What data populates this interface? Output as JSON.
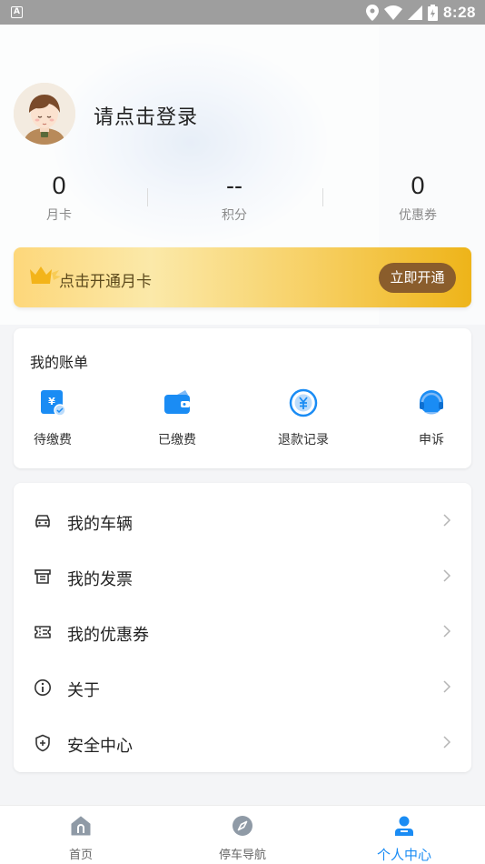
{
  "status_bar": {
    "time": "8:28",
    "app_badge": "A"
  },
  "profile": {
    "login_prompt": "请点击登录"
  },
  "stats": [
    {
      "value": "0",
      "label": "月卡"
    },
    {
      "value": "--",
      "label": "积分"
    },
    {
      "value": "0",
      "label": "优惠券"
    }
  ],
  "banner": {
    "text": "点击开通月卡",
    "button": "立即开通"
  },
  "bills": {
    "title": "我的账单",
    "items": [
      {
        "label": "待缴费",
        "icon": "pending-payment-icon"
      },
      {
        "label": "已缴费",
        "icon": "wallet-icon"
      },
      {
        "label": "退款记录",
        "icon": "yuan-circle-icon"
      },
      {
        "label": "申诉",
        "icon": "customer-service-icon"
      }
    ]
  },
  "menu": [
    {
      "label": "我的车辆",
      "icon": "car-icon"
    },
    {
      "label": "我的发票",
      "icon": "invoice-icon"
    },
    {
      "label": "我的优惠券",
      "icon": "coupon-icon"
    },
    {
      "label": "关于",
      "icon": "info-icon"
    },
    {
      "label": "安全中心",
      "icon": "shield-icon"
    }
  ],
  "nav": [
    {
      "label": "首页",
      "icon": "home-icon"
    },
    {
      "label": "停车导航",
      "icon": "compass-icon"
    },
    {
      "label": "个人中心",
      "icon": "user-icon"
    }
  ],
  "colors": {
    "accent": "#1a8cf4",
    "banner_button": "#8a5d2c",
    "banner_gold": "#f7d064"
  }
}
